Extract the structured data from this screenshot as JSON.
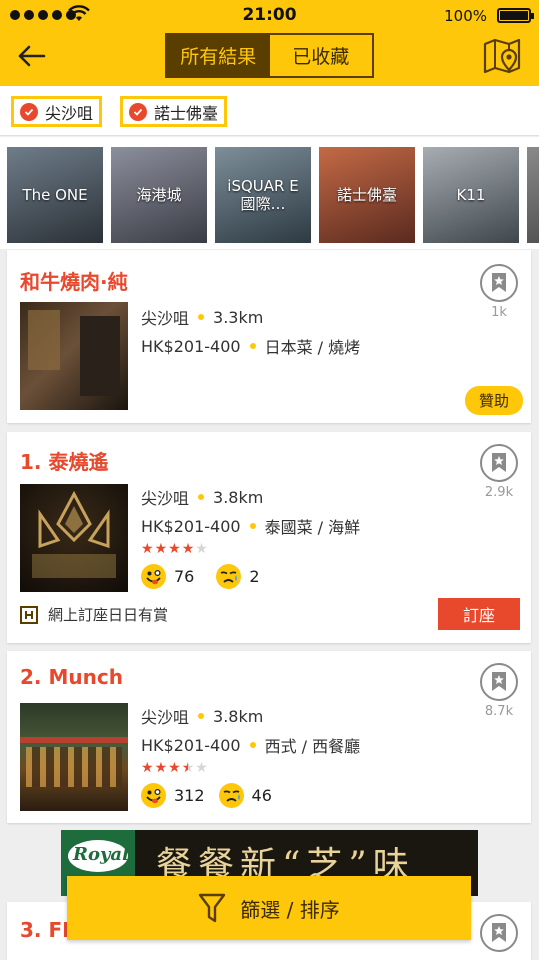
{
  "status": {
    "time": "21:00",
    "battery": "100%"
  },
  "header": {
    "tab_all": "所有結果",
    "tab_saved": "已收藏"
  },
  "filters": [
    "尖沙咀",
    "諾士佛臺"
  ],
  "locations": [
    {
      "name": "The ONE",
      "color": "#3f4a55"
    },
    {
      "name": "海港城",
      "color": "#4a4f5e"
    },
    {
      "name": "iSQUAR E 國際…",
      "color": "#3a4b5a"
    },
    {
      "name": "諾士佛臺",
      "color": "#7a3a2a"
    },
    {
      "name": "K11",
      "color": "#55606a"
    },
    {
      "name": "",
      "color": "#5a5a5a"
    }
  ],
  "sponsored": {
    "title": "和牛燒肉·純",
    "district": "尖沙咀",
    "distance": "3.3km",
    "price": "HK$201-400",
    "cuisine": "日本菜 / 燒烤",
    "bookmarks": "1k",
    "badge": "贊助"
  },
  "restaurants": [
    {
      "title": "1. 泰燒遙",
      "district": "尖沙咀",
      "distance": "3.8km",
      "price": "HK$201-400",
      "cuisine": "泰國菜 / 海鮮",
      "rating": 4,
      "smile": "76",
      "cry": "2",
      "bookmarks": "2.9k",
      "promo": "網上訂座日日有賞",
      "book_label": "訂座"
    },
    {
      "title": "2. Munch",
      "district": "尖沙咀",
      "distance": "3.8km",
      "price": "HK$201-400",
      "cuisine": "西式 / 西餐廳",
      "rating": 3.5,
      "smile": "312",
      "cry": "46",
      "bookmarks": "8.7k"
    },
    {
      "title": "3. FI"
    }
  ],
  "ad": {
    "brand": "Royal",
    "text": "餐餐新“芝”味"
  },
  "filter_bar": {
    "label": "篩選 / 排序"
  }
}
